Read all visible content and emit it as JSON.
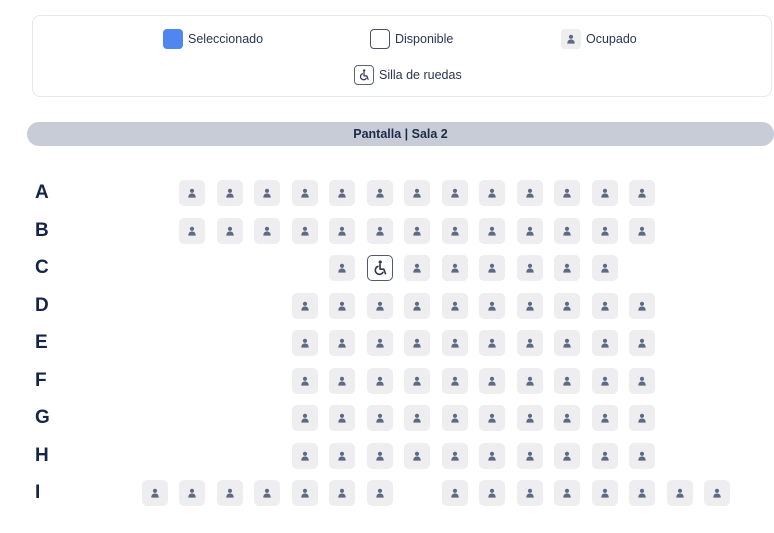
{
  "legend": {
    "selected_label": "Seleccionado",
    "available_label": "Disponible",
    "occupied_label": "Ocupado",
    "wheelchair_label": "Silla de ruedas",
    "colors": {
      "selected": "#4f86f0",
      "occupied_bg": "#eeeef1",
      "person_icon": "#5e6a82"
    },
    "icons": {
      "occupied": "person-icon",
      "wheelchair": "wheelchair-icon"
    }
  },
  "screen": {
    "label": "Pantalla | Sala 2"
  },
  "seatmap": {
    "rows": [
      {
        "label": "A",
        "seats": [
          3,
          4,
          5,
          6,
          7,
          8,
          9,
          10,
          11,
          12,
          13,
          14,
          15
        ],
        "wheelchair": []
      },
      {
        "label": "B",
        "seats": [
          3,
          4,
          5,
          6,
          7,
          8,
          9,
          10,
          11,
          12,
          13,
          14,
          15
        ],
        "wheelchair": []
      },
      {
        "label": "C",
        "seats": [
          7,
          8,
          9,
          10,
          11,
          12,
          13,
          14
        ],
        "wheelchair": [
          8
        ]
      },
      {
        "label": "D",
        "seats": [
          6,
          7,
          8,
          9,
          10,
          11,
          12,
          13,
          14,
          15
        ],
        "wheelchair": []
      },
      {
        "label": "E",
        "seats": [
          6,
          7,
          8,
          9,
          10,
          11,
          12,
          13,
          14,
          15
        ],
        "wheelchair": []
      },
      {
        "label": "F",
        "seats": [
          6,
          7,
          8,
          9,
          10,
          11,
          12,
          13,
          14,
          15
        ],
        "wheelchair": []
      },
      {
        "label": "G",
        "seats": [
          6,
          7,
          8,
          9,
          10,
          11,
          12,
          13,
          14,
          15
        ],
        "wheelchair": []
      },
      {
        "label": "H",
        "seats": [
          6,
          7,
          8,
          9,
          10,
          11,
          12,
          13,
          14,
          15
        ],
        "wheelchair": []
      },
      {
        "label": "I",
        "seats": [
          2,
          3,
          4,
          5,
          6,
          7,
          8,
          10,
          11,
          12,
          13,
          14,
          15,
          16,
          17
        ],
        "wheelchair": []
      }
    ]
  }
}
